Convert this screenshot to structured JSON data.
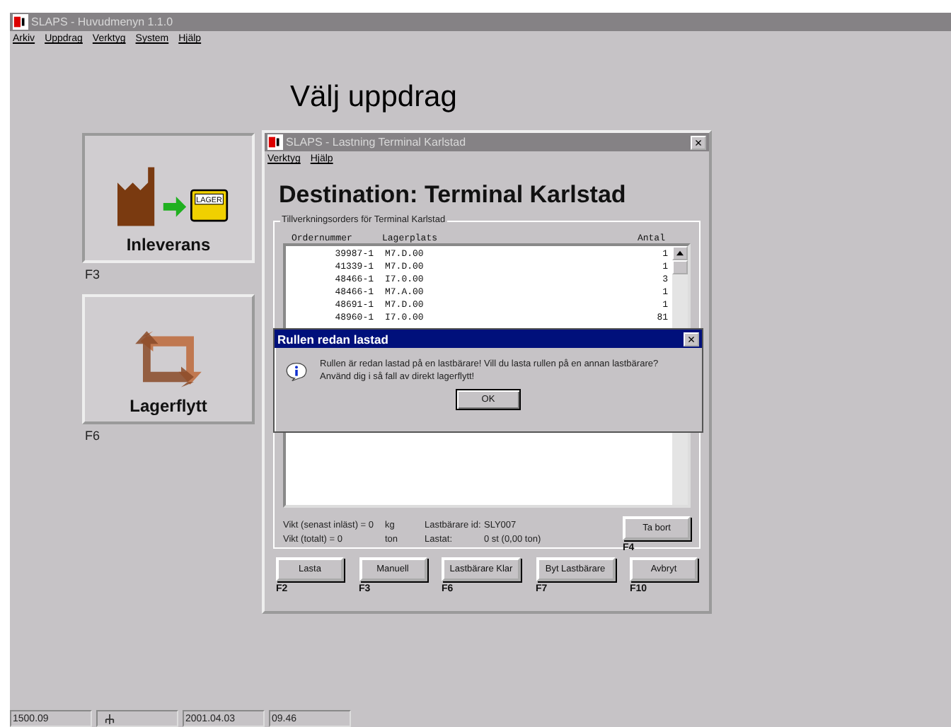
{
  "main_window": {
    "title": "SLAPS - Huvudmenyn 1.1.0",
    "active": false,
    "menu": [
      "Arkiv",
      "Uppdrag",
      "Verktyg",
      "System",
      "Hjälp"
    ],
    "heading": "Välj uppdrag",
    "tiles": [
      {
        "kind": "delivery",
        "label": "Inleverans",
        "key": "F3",
        "badge": "LAGER"
      },
      {
        "kind": "move",
        "label": "Lagerflytt",
        "key": "F6"
      }
    ]
  },
  "dialog": {
    "title": "SLAPS - Lastning Terminal Karlstad",
    "active": false,
    "close": "×",
    "menu": [
      "Verktyg",
      "Hjälp"
    ],
    "heading": "Destination:  Terminal Karlstad",
    "group_label": "Tillverkningsorders för Terminal Karlstad",
    "table": {
      "columns": [
        "Ordernummer",
        "Lagerplats",
        "Antal"
      ],
      "rows": [
        [
          "39987-1",
          "M7.D.00",
          "1"
        ],
        [
          "41339-1",
          "M7.D.00",
          "1"
        ],
        [
          "48466-1",
          "I7.0.00",
          "3"
        ],
        [
          "48466-1",
          "M7.A.00",
          "1"
        ],
        [
          "48691-1",
          "M7.D.00",
          "1"
        ],
        [
          "48960-1",
          "I7.0.00",
          "81"
        ]
      ]
    },
    "info": [
      [
        "Vikt (senast inläst) = 0",
        "kg",
        "Lastbärare id:",
        "SLY007"
      ],
      [
        "Vikt (totalt) = 0",
        "ton",
        "Lastat:",
        "0 st   (0,00 ton)"
      ]
    ],
    "side_button": {
      "label": "Ta bort",
      "key": "F4"
    },
    "buttons": [
      {
        "label": "Lasta",
        "key": "F2"
      },
      {
        "label": "Manuell",
        "key": "F3"
      },
      {
        "label": "Lastbärare Klar",
        "key": "F6"
      },
      {
        "label": "Byt Lastbärare",
        "key": "F7"
      },
      {
        "label": "Avbryt",
        "key": "F10"
      }
    ]
  },
  "message_box": {
    "title": "Rullen redan lastad",
    "active": true,
    "close": "×",
    "lines": [
      "Rullen är redan lastad på en lastbärare! Vill du lasta rullen på en annan lastbärare?",
      "Använd dig i så fall av direkt lagerflytt!"
    ],
    "button": "OK"
  },
  "status_bar": [
    "1500.09",
    "2001.04.03",
    "09.46"
  ]
}
